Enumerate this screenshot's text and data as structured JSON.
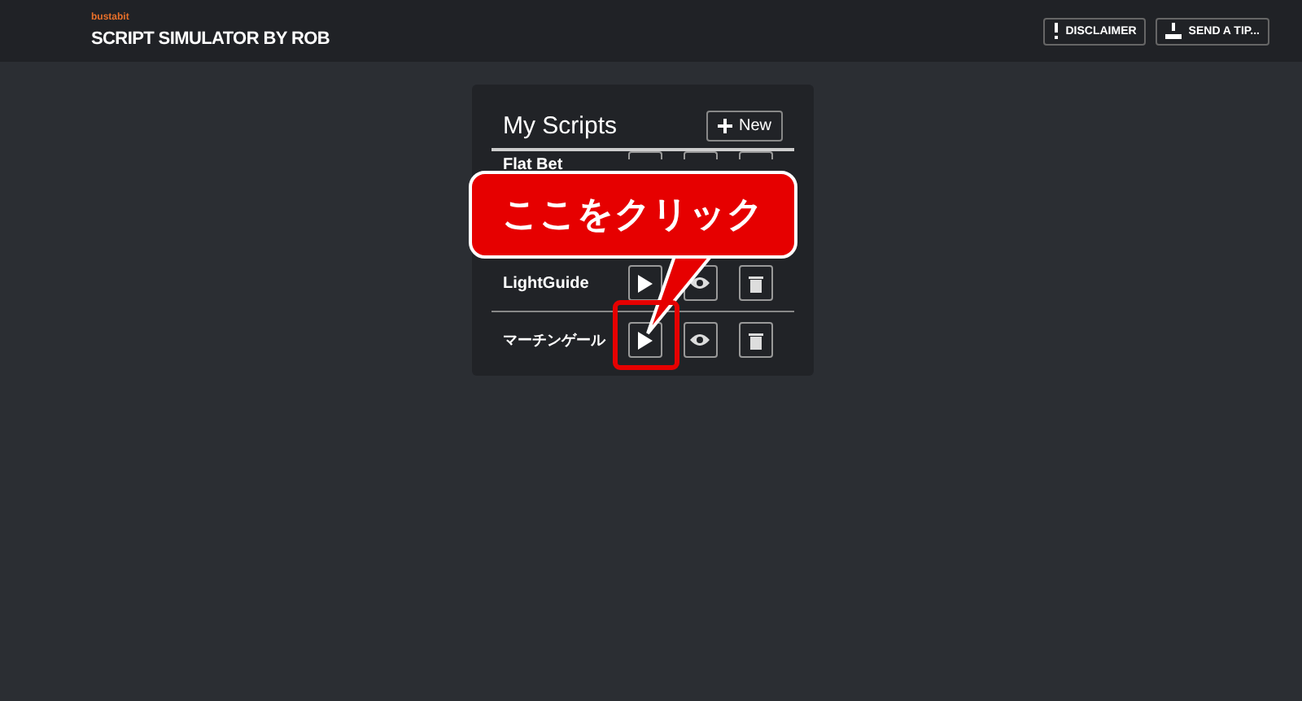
{
  "header": {
    "logo": "bustabit",
    "title": "SCRIPT SIMULATOR BY ROB",
    "buttons": [
      {
        "label": "DISCLAIMER",
        "kind": "disclaimer"
      },
      {
        "label": "SEND A TIP...",
        "kind": "tip"
      }
    ]
  },
  "panel": {
    "title": "My Scripts",
    "new_button": "New",
    "scripts": [
      {
        "name": "Flat Bet"
      },
      {
        "name": "LightGuide"
      },
      {
        "name": "マーチンゲール"
      }
    ]
  },
  "callout": {
    "text": "ここをクリック"
  }
}
